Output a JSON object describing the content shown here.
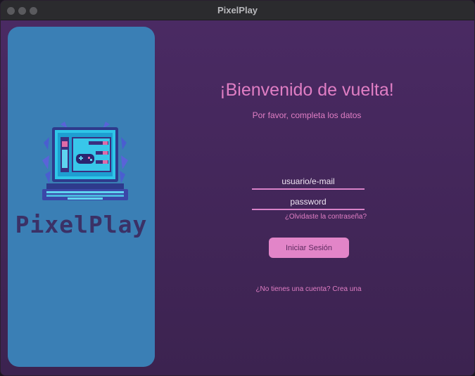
{
  "window": {
    "title": "PixelPlay"
  },
  "brand": {
    "logo_text": "PixelPlay"
  },
  "login": {
    "heading": "¡Bienvenido de vuelta!",
    "subheading": "Por favor, completa los datos",
    "username_placeholder": "usuario/e-mail",
    "password_placeholder": "password",
    "forgot_link": "¿Olvidaste la contraseña?",
    "submit_label": "Iniciar Sesión",
    "signup_link": "¿No tienes una cuenta? Crea una"
  },
  "colors": {
    "background": "#3f2455",
    "side_panel": "#3a7fb5",
    "accent_pink": "#e07ec4",
    "button": "#e285c8",
    "logo_text": "#3b3166"
  },
  "icons": {
    "logo": "retro-computer-gamepad-icon",
    "window_controls": [
      "close-dot",
      "minimize-dot",
      "zoom-dot"
    ]
  }
}
